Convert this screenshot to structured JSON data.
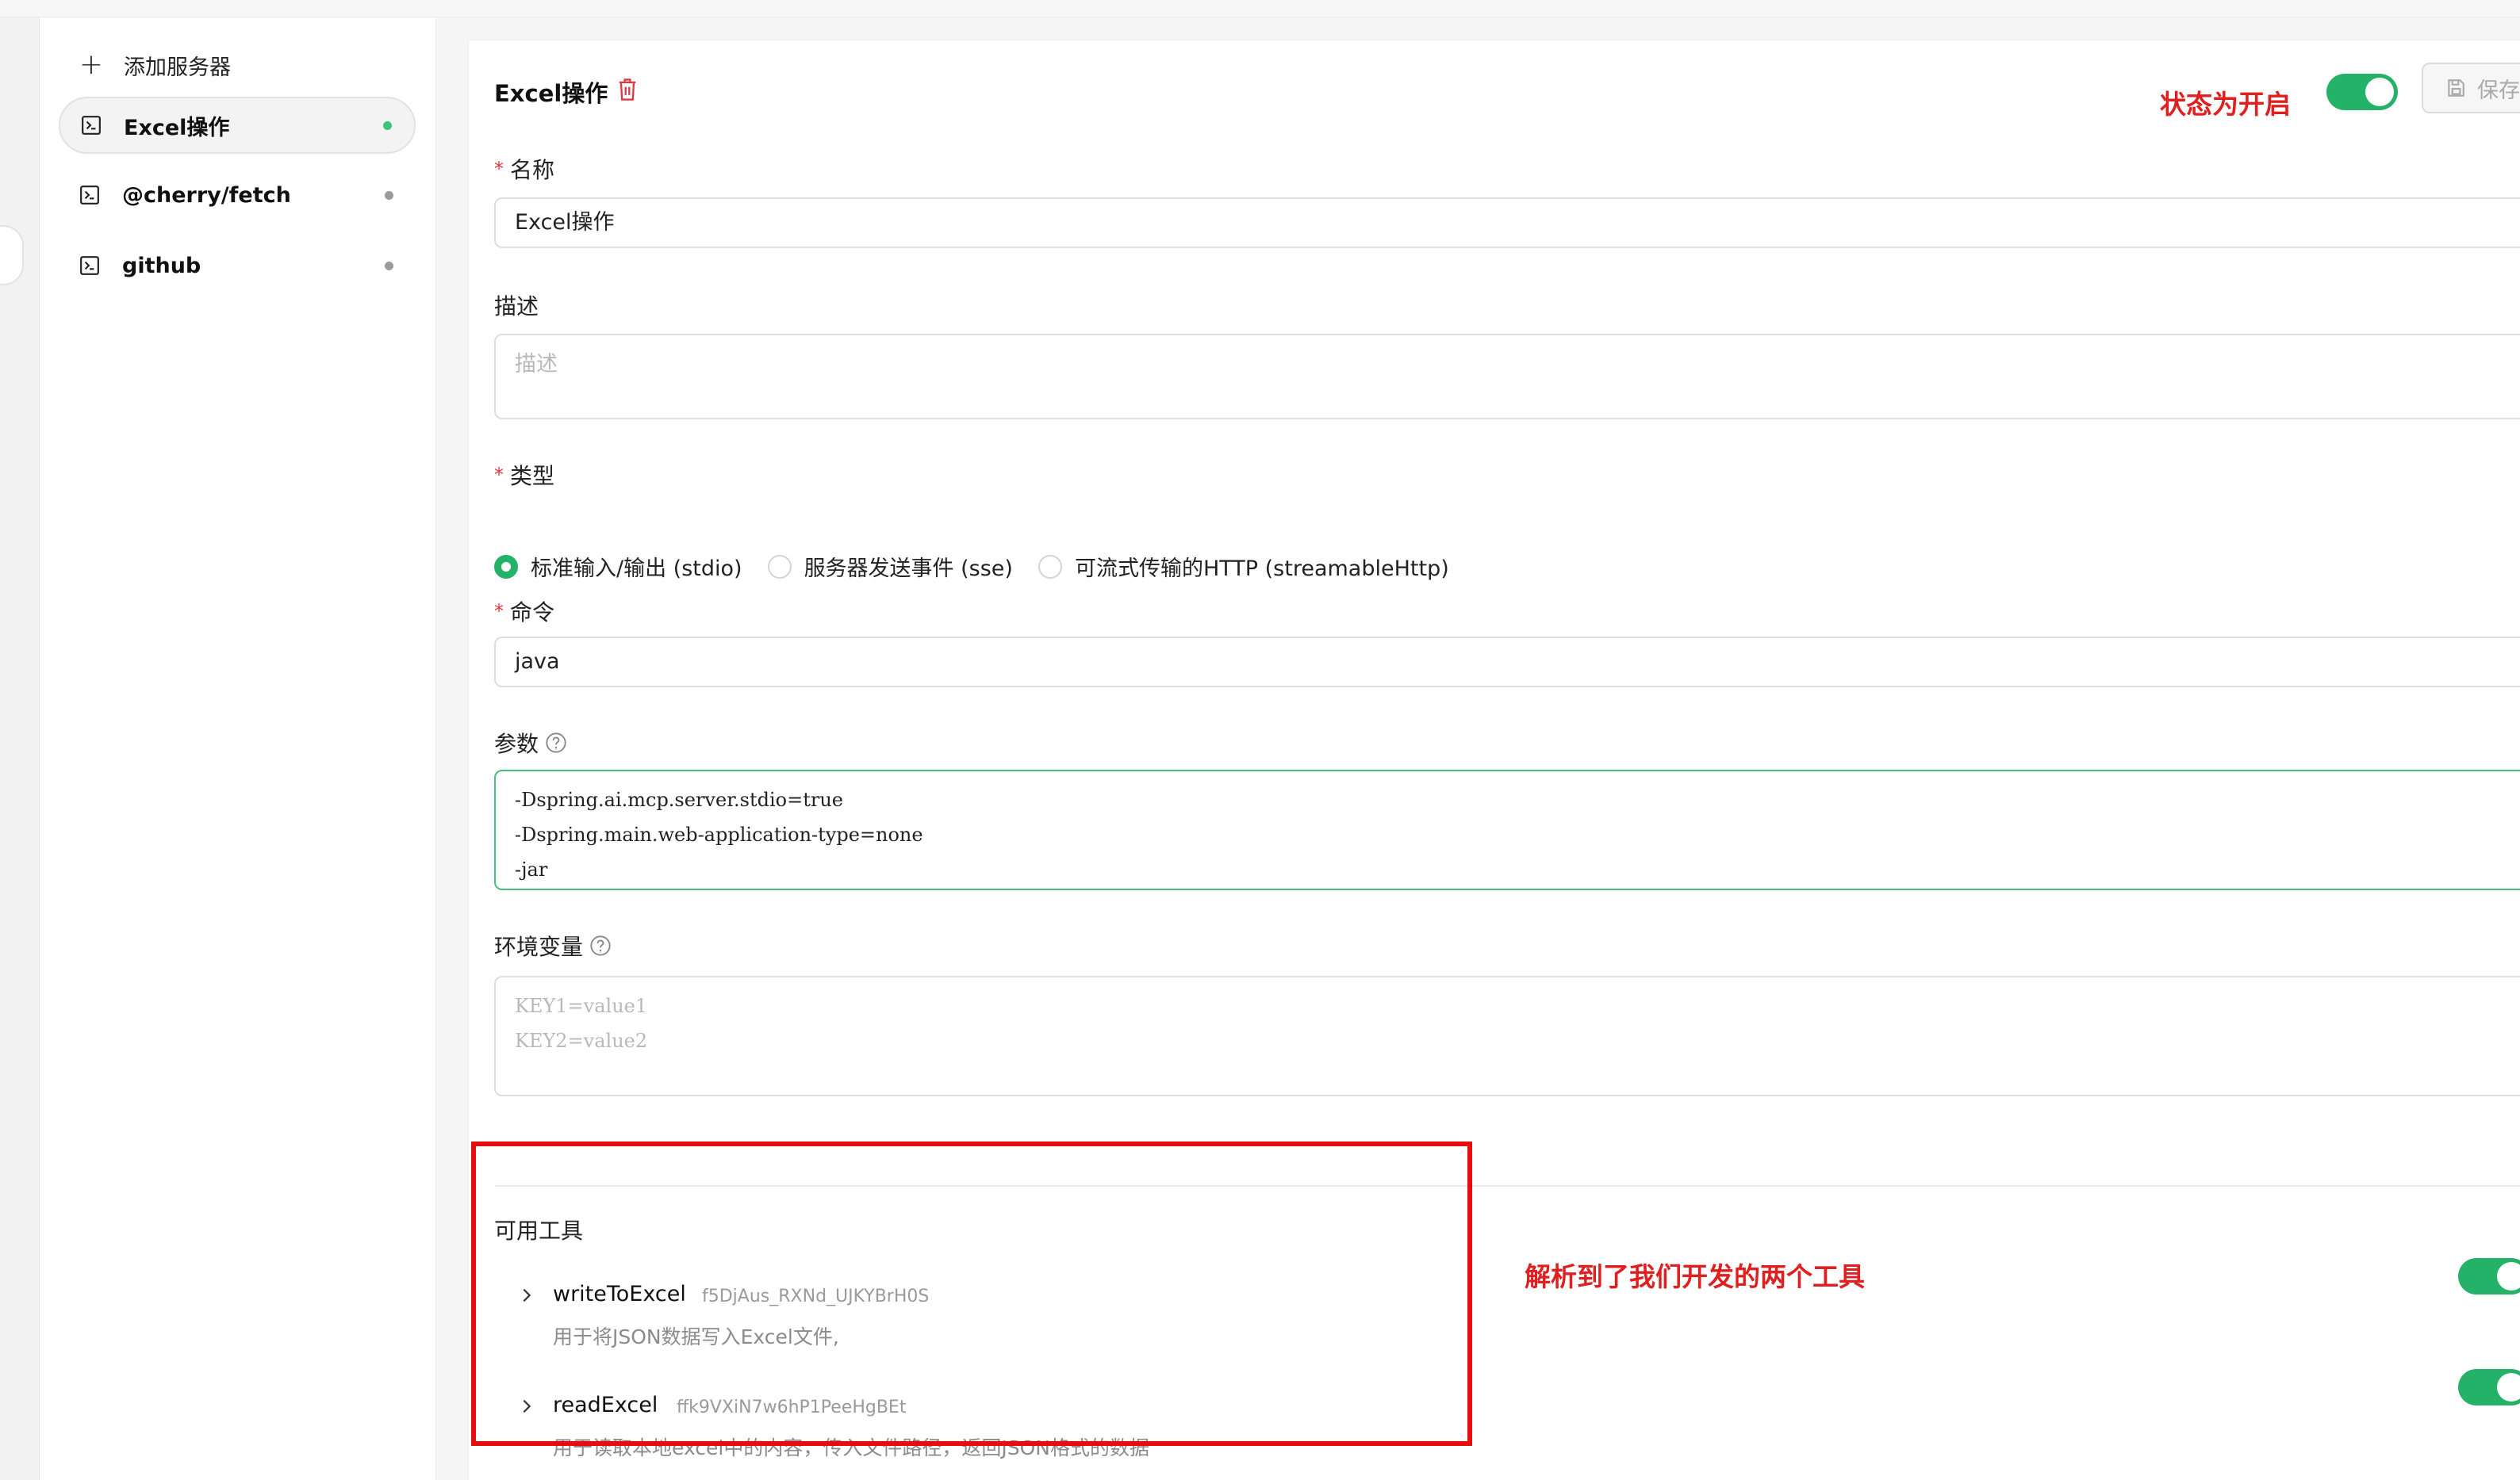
{
  "sidebar": {
    "add_label": "添加服务器",
    "items": [
      {
        "label": "Excel操作",
        "active": true,
        "status_color": "#23b267"
      },
      {
        "label": "@cherry/fetch",
        "active": false,
        "status_color": "#9a9a9a"
      },
      {
        "label": "github",
        "active": false,
        "status_color": "#9a9a9a"
      }
    ]
  },
  "header": {
    "title": "Excel操作",
    "status_note": "状态为开启",
    "save_label": "保存",
    "enabled": true
  },
  "form": {
    "name": {
      "label": "名称",
      "value": "Excel操作"
    },
    "description": {
      "label": "描述",
      "placeholder": "描述"
    },
    "type": {
      "label": "类型",
      "options": [
        "标准输入/输出 (stdio)",
        "服务器发送事件 (sse)",
        "可流式传输的HTTP (streamableHttp)"
      ],
      "selected": "标准输入/输出 (stdio)"
    },
    "command": {
      "label": "命令",
      "value": "java"
    },
    "args": {
      "label": "参数",
      "lines": [
        "-Dspring.ai.mcp.server.stdio=true",
        "-Dspring.main.web-application-type=none",
        "-jar"
      ]
    },
    "env": {
      "label": "环境变量",
      "placeholder_lines": [
        "KEY1=value1",
        "KEY2=value2"
      ]
    }
  },
  "tools": {
    "title": "可用工具",
    "note": "解析到了我们开发的两个工具",
    "items": [
      {
        "name": "writeToExcel",
        "id": "f5DjAus_RXNd_UJKYBrH0S",
        "desc": "用于将JSON数据写入Excel文件,",
        "enabled": true
      },
      {
        "name": "readExcel",
        "id": "ffk9VXiN7w6hP1PeeHgBEt",
        "desc": "用于读取本地excel中的内容，传入文件路径，返回JSON格式的数据",
        "enabled": true
      }
    ]
  },
  "colors": {
    "accent": "#23b267",
    "required": "#e0383e",
    "annotation": "#e02020"
  }
}
